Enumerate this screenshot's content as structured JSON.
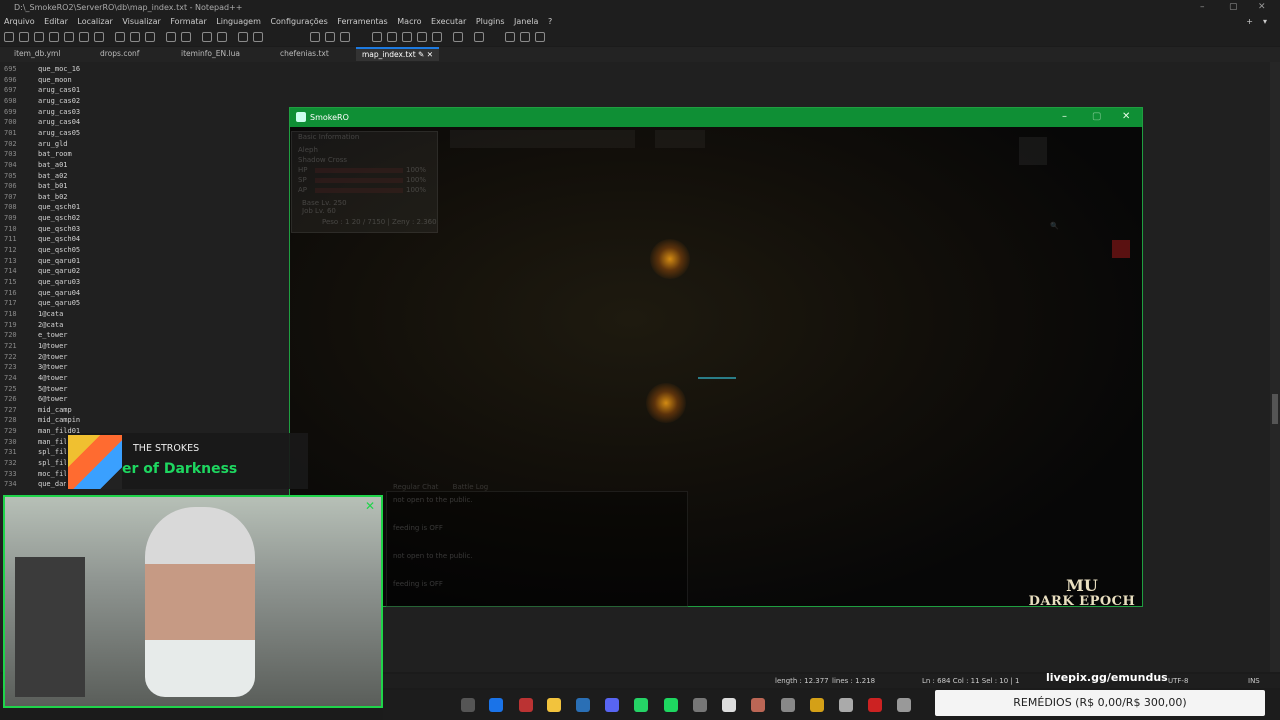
{
  "notepad": {
    "title": "D:\\_SmokeRO2\\ServerRO\\db\\map_index.txt - Notepad++",
    "menu": [
      "Arquivo",
      "Editar",
      "Localizar",
      "Visualizar",
      "Formatar",
      "Linguagem",
      "Configurações",
      "Ferramentas",
      "Macro",
      "Executar",
      "Plugins",
      "Janela",
      "?"
    ],
    "tabs": [
      "item_db.yml",
      "drops.conf",
      "iteminfo_EN.lua",
      "chefenias.txt",
      "map_index.txt"
    ],
    "active_tab": "map_index.txt",
    "lines": [
      {
        "n": "695",
        "t": "que_moc_16"
      },
      {
        "n": "696",
        "t": "que_moon"
      },
      {
        "n": "697",
        "t": "arug_cas01"
      },
      {
        "n": "698",
        "t": "arug_cas02"
      },
      {
        "n": "699",
        "t": "arug_cas03"
      },
      {
        "n": "700",
        "t": "arug_cas04"
      },
      {
        "n": "701",
        "t": "arug_cas05"
      },
      {
        "n": "702",
        "t": "aru_gld"
      },
      {
        "n": "703",
        "t": "bat_room"
      },
      {
        "n": "704",
        "t": "bat_a01"
      },
      {
        "n": "705",
        "t": "bat_a02"
      },
      {
        "n": "706",
        "t": "bat_b01"
      },
      {
        "n": "707",
        "t": "bat_b02"
      },
      {
        "n": "708",
        "t": "que_qsch01"
      },
      {
        "n": "709",
        "t": "que_qsch02"
      },
      {
        "n": "710",
        "t": "que_qsch03"
      },
      {
        "n": "711",
        "t": "que_qsch04"
      },
      {
        "n": "712",
        "t": "que_qsch05"
      },
      {
        "n": "713",
        "t": "que_qaru01"
      },
      {
        "n": "714",
        "t": "que_qaru02"
      },
      {
        "n": "715",
        "t": "que_qaru03"
      },
      {
        "n": "716",
        "t": "que_qaru04"
      },
      {
        "n": "717",
        "t": "que_qaru05"
      },
      {
        "n": "718",
        "t": "1@cata"
      },
      {
        "n": "719",
        "t": "2@cata"
      },
      {
        "n": "720",
        "t": "e_tower"
      },
      {
        "n": "721",
        "t": "1@tower"
      },
      {
        "n": "722",
        "t": "2@tower"
      },
      {
        "n": "723",
        "t": "3@tower"
      },
      {
        "n": "724",
        "t": "4@tower"
      },
      {
        "n": "725",
        "t": "5@tower"
      },
      {
        "n": "726",
        "t": "6@tower"
      },
      {
        "n": "727",
        "t": "mid_camp"
      },
      {
        "n": "728",
        "t": "mid_campin"
      },
      {
        "n": "729",
        "t": "man_fild01"
      },
      {
        "n": "730",
        "t": "man_fil"
      },
      {
        "n": "731",
        "t": "spl_fil"
      },
      {
        "n": "732",
        "t": "spl_fil"
      },
      {
        "n": "733",
        "t": "moc_fil"
      },
      {
        "n": "734",
        "t": "que_dan"
      }
    ],
    "status": {
      "length": "length : 12.377",
      "lines": "lines : 1.218",
      "pos": "Ln : 684   Col : 11   Sel : 10 | 1",
      "encoding": "UTF-8",
      "mode": "INS"
    }
  },
  "game": {
    "title": "SmokeRO",
    "info": {
      "header": "Basic Information",
      "name": "Aleph",
      "class": "Shadow Cross",
      "hp_label": "HP",
      "hp_pct": "100%",
      "sp_label": "SP",
      "sp_pct": "100%",
      "ap_label": "AP",
      "ap_pct": "100%",
      "base": "Base Lv. 250",
      "job": "Job Lv. 60",
      "weight": "Peso : 1 20 / 7150 | Zeny : 2.360"
    },
    "chat": {
      "tab1": "Regular Chat",
      "tab2": "Battle Log",
      "lines": [
        "not open to the public.",
        "feeding is OFF",
        "not open to the public.",
        "feeding is OFF"
      ]
    }
  },
  "overlay": {
    "np_artist": "THE STROKES",
    "np_song": "er of Darkness",
    "logo_top": "MU",
    "logo_bottom": "DARK EPOCH",
    "livepix": "livepix.gg/emundus",
    "remedios": "REMÉDIOS (R$ 0,00/R$ 300,00)"
  },
  "colors": {
    "accent_green": "#0f8f35",
    "spotify_green": "#1ed760",
    "tab_blue": "#1d7ae0"
  }
}
